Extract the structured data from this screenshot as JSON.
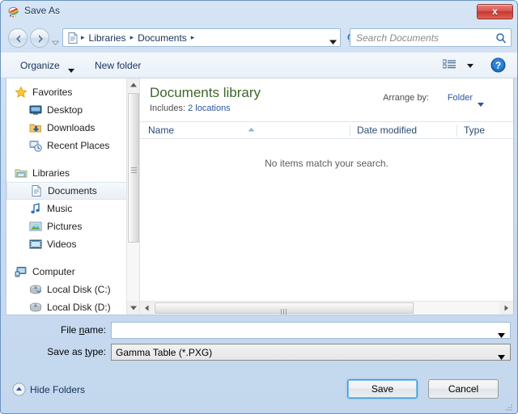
{
  "window": {
    "title": "Save As",
    "icon": "application-icon",
    "close_label": "x"
  },
  "navigation": {
    "back_icon": "back-arrow-icon",
    "forward_icon": "forward-arrow-icon",
    "recent_dropdown_icon": "chevron-down-icon",
    "address_icon": "document-icon",
    "breadcrumbs": [
      {
        "label": "Libraries"
      },
      {
        "label": "Documents"
      }
    ],
    "separator": "▸",
    "address_dropdown_icon": "chevron-down-icon",
    "refresh_icon": "refresh-icon",
    "search": {
      "placeholder": "Search Documents",
      "value": "",
      "icon": "search-icon"
    }
  },
  "toolbar": {
    "organize_label": "Organize",
    "organize_caret_icon": "caret-down-icon",
    "new_folder_label": "New folder",
    "view_icon": "view-list-icon",
    "view_caret_icon": "caret-down-icon",
    "help_icon": "help-icon"
  },
  "nav_pane": {
    "groups": [
      {
        "header": {
          "label": "Favorites",
          "icon": "star-icon"
        },
        "items": [
          {
            "label": "Desktop",
            "icon": "desktop-icon",
            "selected": false
          },
          {
            "label": "Downloads",
            "icon": "downloads-folder-icon",
            "selected": false
          },
          {
            "label": "Recent Places",
            "icon": "recent-places-icon",
            "selected": false
          }
        ]
      },
      {
        "header": {
          "label": "Libraries",
          "icon": "libraries-folder-icon"
        },
        "items": [
          {
            "label": "Documents",
            "icon": "documents-icon",
            "selected": true
          },
          {
            "label": "Music",
            "icon": "music-note-icon",
            "selected": false
          },
          {
            "label": "Pictures",
            "icon": "pictures-icon",
            "selected": false
          },
          {
            "label": "Videos",
            "icon": "videos-icon",
            "selected": false
          }
        ]
      },
      {
        "header": {
          "label": "Computer",
          "icon": "computer-icon"
        },
        "items": [
          {
            "label": "Local Disk (C:)",
            "icon": "hard-disk-icon",
            "selected": false
          },
          {
            "label": "Local Disk (D:)",
            "icon": "hard-disk-icon",
            "selected": false
          }
        ]
      }
    ],
    "scrollbar": {
      "up_icon": "scroll-up-arrow-icon",
      "down_icon": "scroll-down-arrow-icon"
    }
  },
  "file_pane": {
    "library_title": "Documents library",
    "includes_label": "Includes:",
    "includes_link": "2 locations",
    "arrange_label": "Arrange by:",
    "arrange_value": "Folder",
    "arrange_caret_icon": "caret-down-icon",
    "columns": [
      {
        "label": "Name",
        "sorted": "asc"
      },
      {
        "label": "Date modified",
        "sorted": ""
      },
      {
        "label": "Type",
        "sorted": ""
      }
    ],
    "sort_indicator_icon": "sort-ascending-icon",
    "empty_message": "No items match your search.",
    "rows": [],
    "hscrollbar": {
      "left_icon": "scroll-left-arrow-icon",
      "right_icon": "scroll-right-arrow-icon"
    }
  },
  "form": {
    "file_name": {
      "label_pre": "File ",
      "label_accel": "n",
      "label_post": "ame:",
      "value": "",
      "dropdown_icon": "caret-down-icon"
    },
    "save_as_type": {
      "label_pre": "Save as ",
      "label_accel": "t",
      "label_post": "ype:",
      "value": "Gamma Table (*.PXG)",
      "dropdown_icon": "caret-down-icon"
    }
  },
  "footer": {
    "hide_folders_label": "Hide Folders",
    "hide_folders_icon": "collapse-up-icon",
    "save_label": "Save",
    "cancel_label": "Cancel",
    "resize_grip_icon": "resize-grip-icon"
  },
  "colors": {
    "accent_blue": "#2a56a0",
    "library_green": "#3f6529",
    "title_text": "#16335c",
    "close_red": "#c23a32",
    "focus_blue": "#3c9bdb"
  }
}
